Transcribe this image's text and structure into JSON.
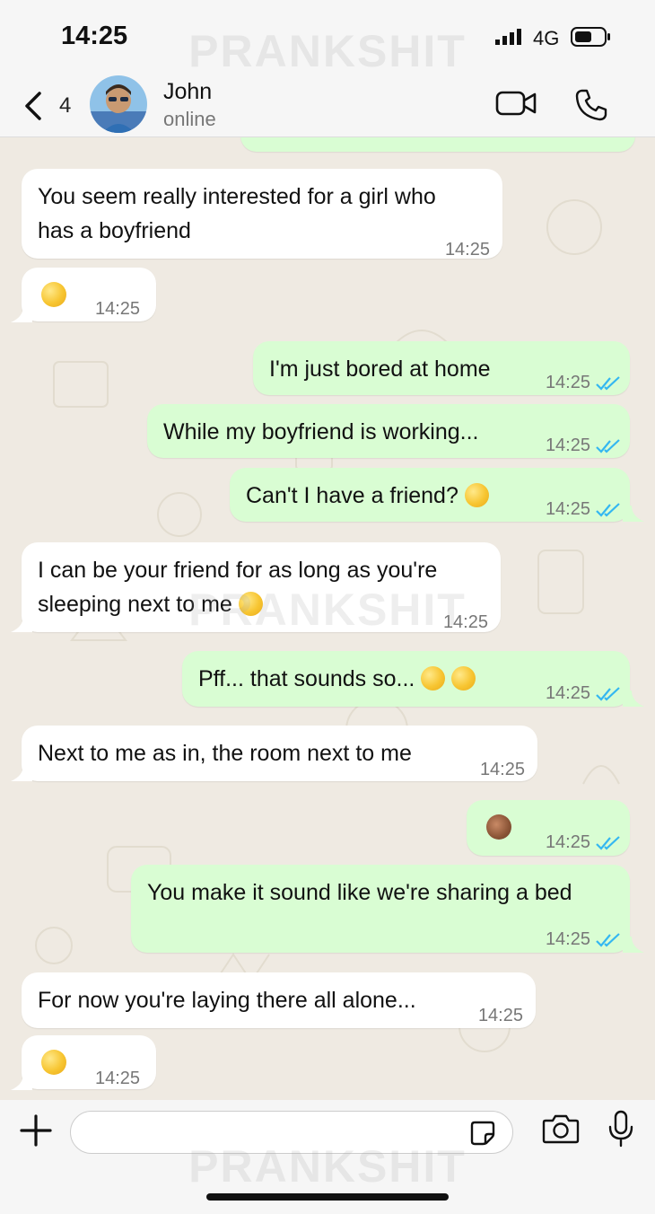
{
  "status_bar": {
    "time": "14:25",
    "network": "4G"
  },
  "watermark": "PRANKSHIT",
  "header": {
    "back_count": "4",
    "contact_name": "John",
    "contact_status": "online"
  },
  "messages": [
    {
      "dir": "in",
      "lines": [
        "You seem really interested for a girl who",
        "has a boyfriend"
      ],
      "time": "14:25"
    },
    {
      "dir": "in",
      "emoji": "face-with-rolling-eyes",
      "time": "14:25"
    },
    {
      "dir": "out",
      "text": "I'm just bored at home",
      "time": "14:25",
      "read": true
    },
    {
      "dir": "out",
      "text": "While my boyfriend is working...",
      "time": "14:25",
      "read": true
    },
    {
      "dir": "out",
      "text": "Can't I have a friend?",
      "emoji": "grinning-face-with-sweat",
      "time": "14:25",
      "read": true
    },
    {
      "dir": "in",
      "lines": [
        "I can be your friend for as long as you're",
        "sleeping next to me"
      ],
      "emoji": "zany-face",
      "time": "14:25"
    },
    {
      "dir": "out",
      "text": "Pff... that sounds so...",
      "emoji": "flushed-face, face-with-hand-over-mouth",
      "time": "14:25",
      "read": true
    },
    {
      "dir": "in",
      "text": "Next to me as in, the room next to me",
      "time": "14:25"
    },
    {
      "dir": "out",
      "emoji": "see-no-evil-monkey",
      "time": "14:25",
      "read": true
    },
    {
      "dir": "out",
      "text": "You make it sound like we're sharing a bed",
      "time": "14:25",
      "read": true
    },
    {
      "dir": "in",
      "text": "For now you're laying there all alone...",
      "time": "14:25"
    },
    {
      "dir": "in",
      "emoji": "face-with-tongue",
      "time": "14:25"
    }
  ],
  "input": {
    "placeholder": ""
  },
  "colors": {
    "incoming": "#ffffff",
    "outgoing": "#d9fdd3",
    "read_ticks": "#34b7f1",
    "background": "#efeae2"
  }
}
